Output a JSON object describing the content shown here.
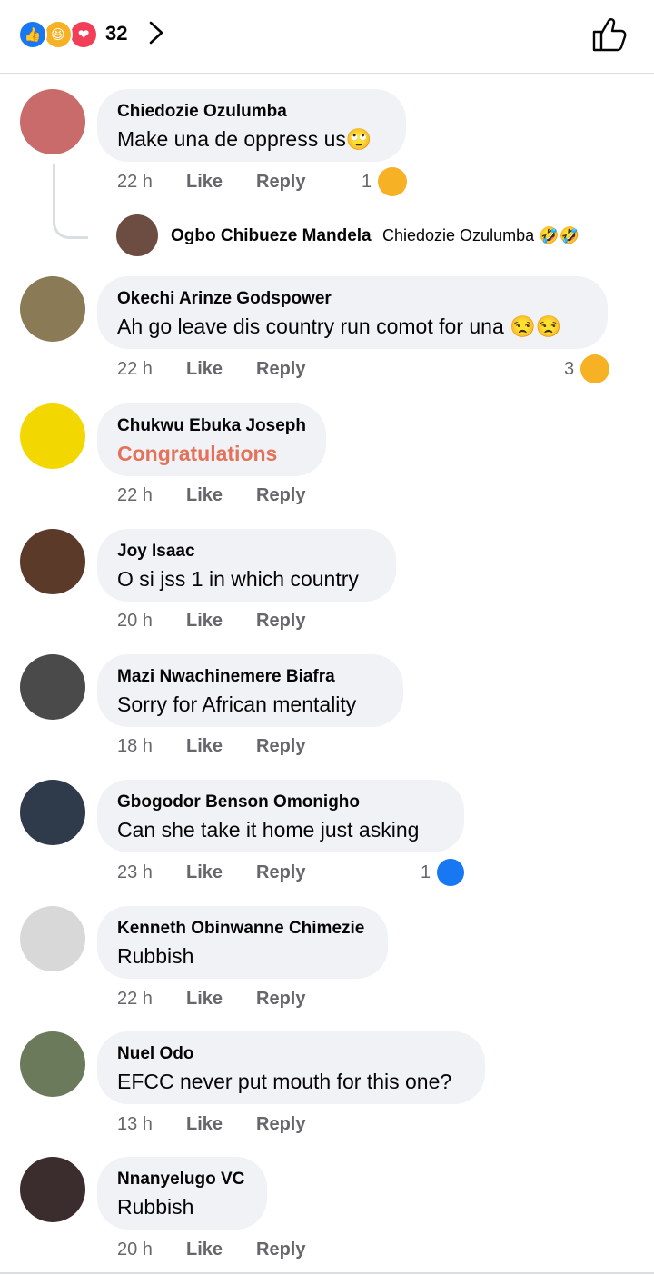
{
  "reactions": {
    "count": "32",
    "icons": [
      "like-icon",
      "haha-icon",
      "love-icon"
    ]
  },
  "colors": {
    "accent": "#1877f2",
    "bubble": "#f0f2f5",
    "meta": "#65676b",
    "highlight": "#e4725a"
  },
  "comments": [
    {
      "name": "Chiedozie Ozulumba",
      "text": "Make una de oppress us🙄",
      "time": "22 h",
      "like": "Like",
      "reply": "Reply",
      "reaction_count": "1",
      "reaction": "haha-icon"
    },
    {
      "name": "Okechi Arinze Godspower",
      "text": "Ah go leave dis country run comot for una 😒😒",
      "time": "22 h",
      "like": "Like",
      "reply": "Reply",
      "reaction_count": "3",
      "reaction": "haha-icon"
    },
    {
      "name": "Chukwu Ebuka Joseph",
      "text": "Congratulations",
      "time": "22 h",
      "like": "Like",
      "reply": "Reply"
    },
    {
      "name": "Joy Isaac",
      "text": "O si jss 1 in which country",
      "time": "20 h",
      "like": "Like",
      "reply": "Reply"
    },
    {
      "name": "Mazi Nwachinemere Biafra",
      "text": "Sorry for African mentality",
      "time": "18 h",
      "like": "Like",
      "reply": "Reply"
    },
    {
      "name": "Gbogodor Benson Omonigho",
      "text": "Can she take it home just asking",
      "time": "23 h",
      "like": "Like",
      "reply": "Reply",
      "reaction_count": "1",
      "reaction": "like-icon"
    },
    {
      "name": "Kenneth Obinwanne Chimezie",
      "text": "Rubbish",
      "time": "22 h",
      "like": "Like",
      "reply": "Reply"
    },
    {
      "name": "Nuel Odo",
      "text": "EFCC never put mouth for this one?",
      "time": "13 h",
      "like": "Like",
      "reply": "Reply"
    },
    {
      "name": "Nnanyelugo VC",
      "text": "Rubbish",
      "time": "20 h",
      "like": "Like",
      "reply": "Reply"
    }
  ],
  "reply_preview": {
    "name": "Ogbo Chibueze Mandela",
    "text": "Chiedozie Ozulumba 🤣🤣"
  }
}
